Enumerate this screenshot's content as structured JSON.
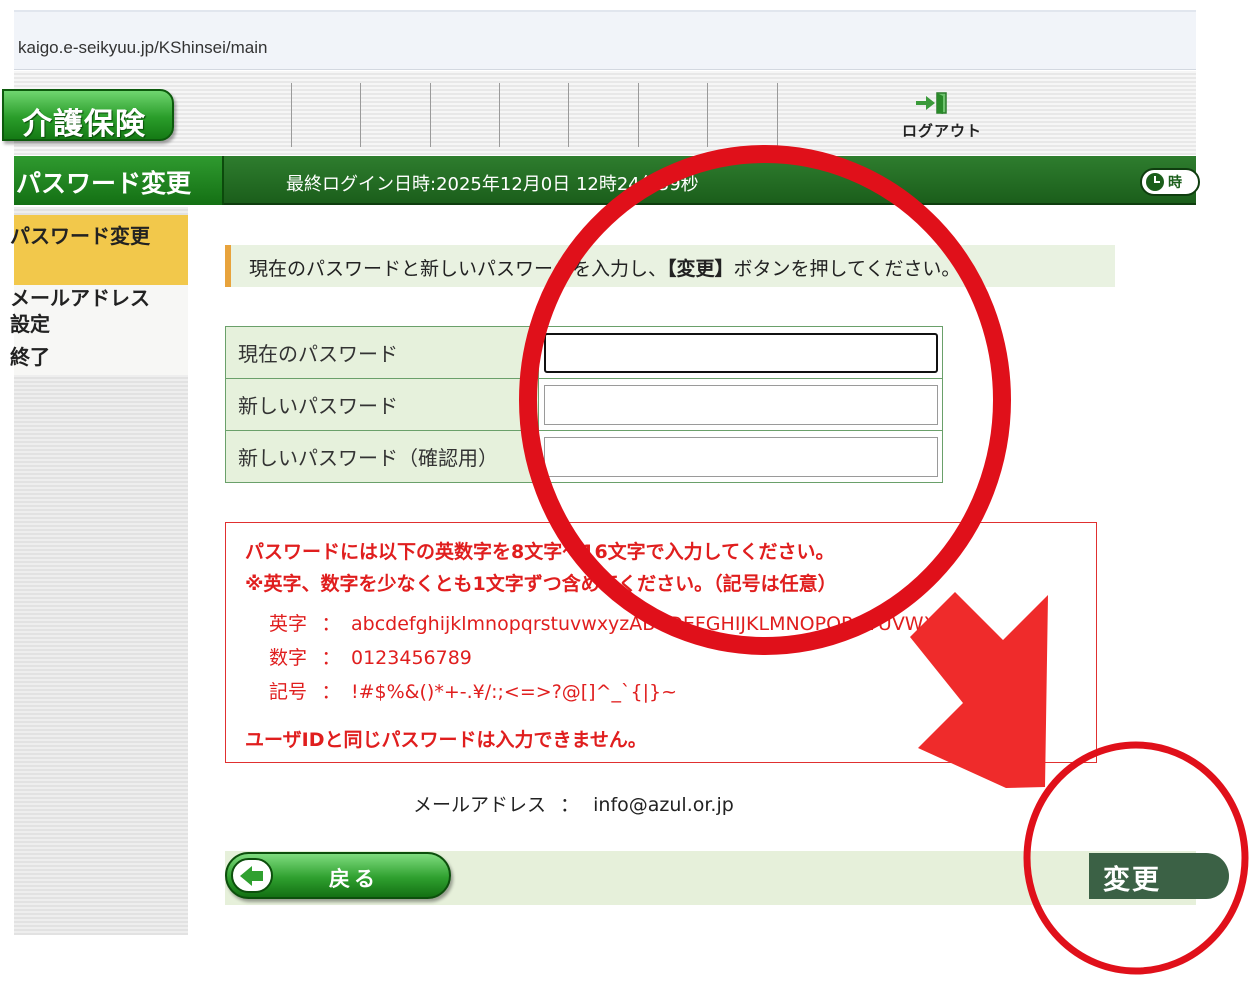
{
  "browser": {
    "url": "kaigo.e-seikyuu.jp/KShinsei/main"
  },
  "header": {
    "app_title": "介護保険",
    "logout_label": "ログアウト"
  },
  "titlebar": {
    "page_title": "パスワード変更",
    "last_login": "最終ログイン日時:2025年12月0",
    "last_login_tail": "日 12時24分39秒",
    "clock_label": "時"
  },
  "sidebar": {
    "items": [
      {
        "label": "パスワード変更",
        "active": true
      },
      {
        "label": "メールアドレス\n設定",
        "active": false
      },
      {
        "label": "終了",
        "active": false
      }
    ]
  },
  "instruction": {
    "before": "現在のパスワードと新しいパスワードを入力し、",
    "bold": "【変更】",
    "after": "ボタンを押してください。"
  },
  "form": {
    "rows": [
      {
        "label": "現在のパスワード",
        "value": ""
      },
      {
        "label": "新しいパスワード",
        "value": ""
      },
      {
        "label": "新しいパスワード（確認用）",
        "value": ""
      }
    ]
  },
  "rules": {
    "line1": "パスワードには以下の英数字を8文字～16文字で入力してください。",
    "line2": "※英字、数字を少なくとも1文字ずつ含めてください。（記号は任意）",
    "alpha_key": "英字",
    "alpha_val": "abcdefghijklmnopqrstuvwxyzABCDEFGHIJKLMNOPQRSTUVWXYZ",
    "num_key": "数字",
    "num_val": "0123456789",
    "sym_key": "記号",
    "sym_val": "!#$%&()*+-.¥/:;<=>?@[]^_`{|}~",
    "separator": "：",
    "note": "ユーザIDと同じパスワードは入力できません。"
  },
  "email": {
    "label": "メールアドレス",
    "separator": "：",
    "value": "info@azul.or.jp"
  },
  "buttons": {
    "back_label": "戻る",
    "change_label": "変更"
  },
  "colors": {
    "annotation_red": "#e0101a",
    "header_green": "#1b5e1b",
    "alert_red": "#e01e1e"
  }
}
